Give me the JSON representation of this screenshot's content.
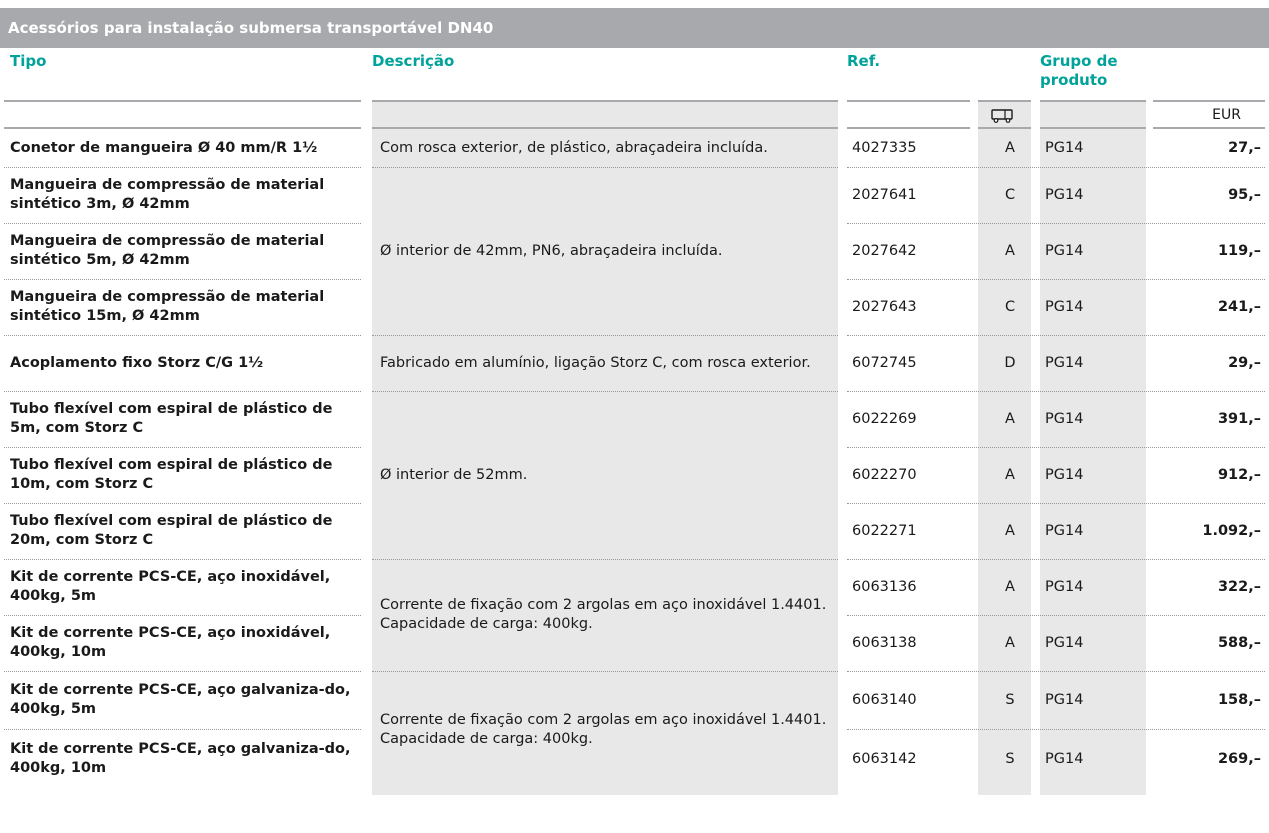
{
  "title": "Acessórios para instalação submersa transportável DN40",
  "headers": {
    "tipo": "Tipo",
    "descricao": "Descrição",
    "ref": "Ref.",
    "grupo": "Grupo de produto",
    "currency": "EUR",
    "delivery_icon": "truck-icon"
  },
  "colors": {
    "title_bg": "#a7a9ac",
    "header_text": "#00a29a",
    "shade": "#e8e8e9"
  },
  "rows": [
    {
      "tipo": "Conetor de mangueira Ø 40 mm/R 1½",
      "ref": "4027335",
      "cat": "A",
      "grupo": "PG14",
      "price": "27,–"
    },
    {
      "tipo": "Mangueira de compressão de material sintético 3m, Ø 42mm",
      "ref": "2027641",
      "cat": "C",
      "grupo": "PG14",
      "price": "95,–"
    },
    {
      "tipo": "Mangueira de compressão de material sintético 5m, Ø 42mm",
      "ref": "2027642",
      "cat": "A",
      "grupo": "PG14",
      "price": "119,–"
    },
    {
      "tipo": "Mangueira de compressão de material sintético 15m, Ø 42mm",
      "ref": "2027643",
      "cat": "C",
      "grupo": "PG14",
      "price": "241,–"
    },
    {
      "tipo": "Acoplamento fixo Storz C/G 1½",
      "ref": "6072745",
      "cat": "D",
      "grupo": "PG14",
      "price": "29,–"
    },
    {
      "tipo": "Tubo flexível com espiral de plástico de 5m, com Storz C",
      "ref": "6022269",
      "cat": "A",
      "grupo": "PG14",
      "price": "391,–"
    },
    {
      "tipo": "Tubo flexível com espiral de plástico de 10m, com Storz C",
      "ref": "6022270",
      "cat": "A",
      "grupo": "PG14",
      "price": "912,–"
    },
    {
      "tipo": "Tubo flexível com espiral de plástico de 20m, com Storz C",
      "ref": "6022271",
      "cat": "A",
      "grupo": "PG14",
      "price": "1.092,–"
    },
    {
      "tipo": "Kit de corrente PCS-CE, aço inoxidável, 400kg, 5m",
      "ref": "6063136",
      "cat": "A",
      "grupo": "PG14",
      "price": "322,–"
    },
    {
      "tipo": "Kit de corrente PCS-CE, aço inoxidável, 400kg, 10m",
      "ref": "6063138",
      "cat": "A",
      "grupo": "PG14",
      "price": "588,–"
    },
    {
      "tipo": "Kit de corrente PCS-CE, aço galvaniza-do, 400kg, 5m",
      "ref": "6063140",
      "cat": "S",
      "grupo": "PG14",
      "price": "158,–"
    },
    {
      "tipo": "Kit de corrente PCS-CE, aço galvaniza-do, 400kg, 10m",
      "ref": "6063142",
      "cat": "S",
      "grupo": "PG14",
      "price": "269,–"
    }
  ],
  "descriptions": [
    {
      "text": "Com rosca exterior, de plástico, abraçadeira incluída."
    },
    {
      "text": "Ø interior de 42mm, PN6, abraçadeira incluída."
    },
    {
      "text": "Fabricado em alumínio, ligação Storz C, com rosca exterior."
    },
    {
      "text": "Ø interior de 52mm."
    },
    {
      "text": "Corrente de fixação com 2 argolas em aço inoxidável 1.4401. Capacidade de carga: 400kg."
    },
    {
      "text": "Corrente de fixação com 2 argolas em aço inoxidável 1.4401. Capacidade de carga: 400kg."
    }
  ]
}
